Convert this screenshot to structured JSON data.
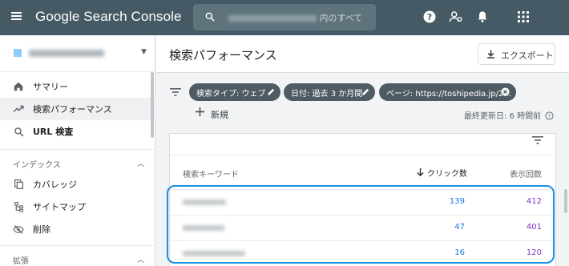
{
  "header": {
    "app_title": "Google Search Console",
    "search_placeholder": "内のすべて",
    "icons": [
      "menu-icon",
      "search-icon",
      "help-icon",
      "manage-users-icon",
      "notifications-icon",
      "apps-icon"
    ]
  },
  "sidebar": {
    "nav": [
      {
        "label": "サマリー",
        "icon": "home-icon"
      },
      {
        "label": "検索パフォーマンス",
        "icon": "trending-up-icon",
        "active": true
      },
      {
        "label": "URL 検査",
        "icon": "search-icon"
      }
    ],
    "sections": [
      {
        "title": "インデックス",
        "items": [
          {
            "label": "カバレッジ",
            "icon": "coverage-icon"
          },
          {
            "label": "サイトマップ",
            "icon": "sitemap-icon"
          },
          {
            "label": "削除",
            "icon": "removals-icon"
          }
        ]
      },
      {
        "title": "拡張",
        "items": []
      }
    ]
  },
  "main": {
    "title": "検索パフォーマンス",
    "export_label": "エクスポート",
    "filters": [
      {
        "label": "検索タイプ: ウェブ",
        "action": "edit"
      },
      {
        "label": "日付: 過去 3 か月間",
        "action": "edit"
      },
      {
        "label": "ページ: https://toshipedia.jp/2...",
        "action": "remove"
      }
    ],
    "new_label": "新規",
    "last_updated": "最終更新日: 6 時間前"
  },
  "table": {
    "columns": {
      "query": "検索キーワード",
      "clicks": "クリック数",
      "impressions": "表示回数"
    },
    "sort_column": "clicks",
    "rows": [
      {
        "clicks": "139",
        "impressions": "412"
      },
      {
        "clicks": "47",
        "impressions": "401"
      },
      {
        "clicks": "16",
        "impressions": "120"
      }
    ]
  },
  "colors": {
    "topbar": "#455a64",
    "clicks": "#1a73e8",
    "impressions": "#8430ce",
    "highlight": "#1a8fe3"
  }
}
